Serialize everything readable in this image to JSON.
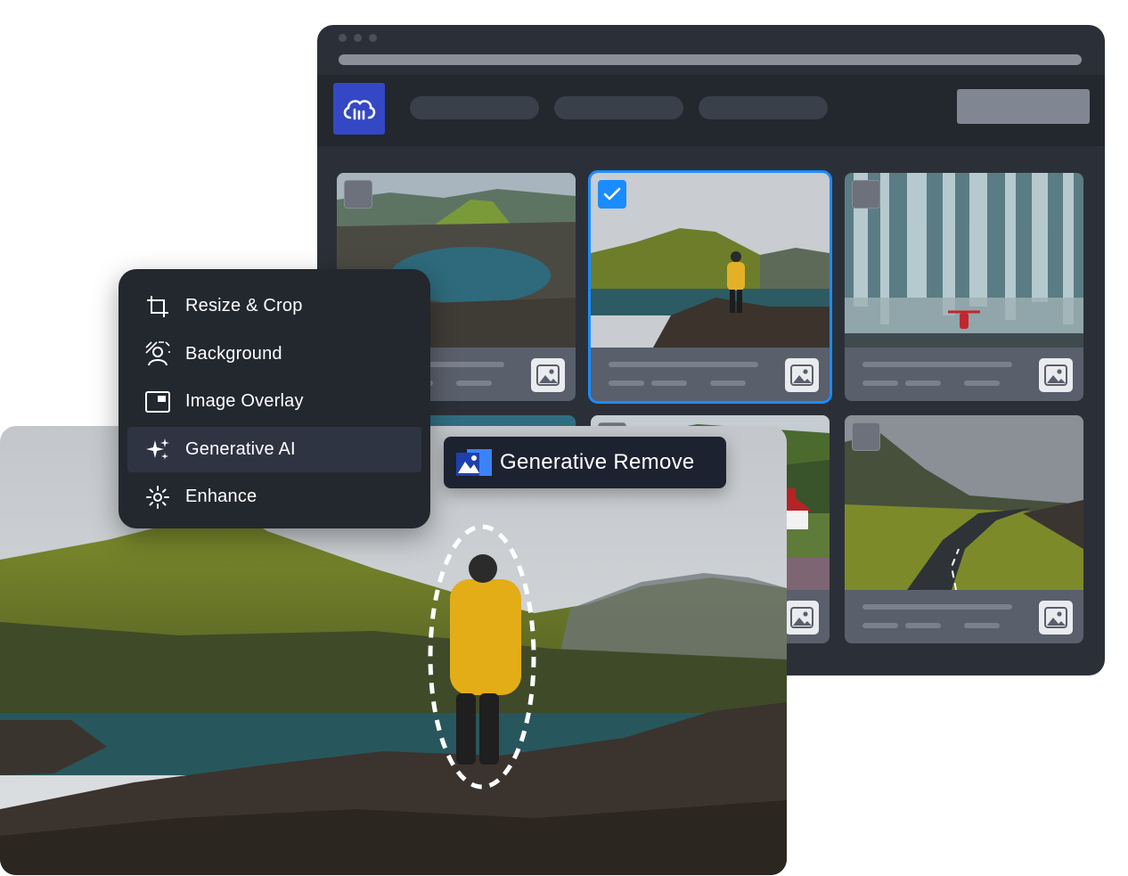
{
  "menu": {
    "items": [
      {
        "label": "Resize & Crop",
        "icon": "crop-icon",
        "active": false
      },
      {
        "label": "Background",
        "icon": "background-removal-icon",
        "active": false
      },
      {
        "label": "Image Overlay",
        "icon": "image-overlay-icon",
        "active": false
      },
      {
        "label": "Generative AI",
        "icon": "sparkles-icon",
        "active": true
      },
      {
        "label": "Enhance",
        "icon": "enhance-icon",
        "active": false
      }
    ]
  },
  "badge": {
    "label": "Generative Remove",
    "icon": "generative-remove-icon"
  },
  "app": {
    "logo": "cloud-logo-icon",
    "brand_color": "#3448c5"
  },
  "gallery": {
    "selected_index": 1,
    "accent_color": "#1a8cff",
    "cards": [
      {
        "scene": "volcanic crater lake aerial"
      },
      {
        "scene": "hiker in yellow jacket by lake"
      },
      {
        "scene": "person before waterfall"
      },
      {
        "scene": "lake view"
      },
      {
        "scene": "village with red roof church"
      },
      {
        "scene": "winding road through hills"
      }
    ]
  }
}
